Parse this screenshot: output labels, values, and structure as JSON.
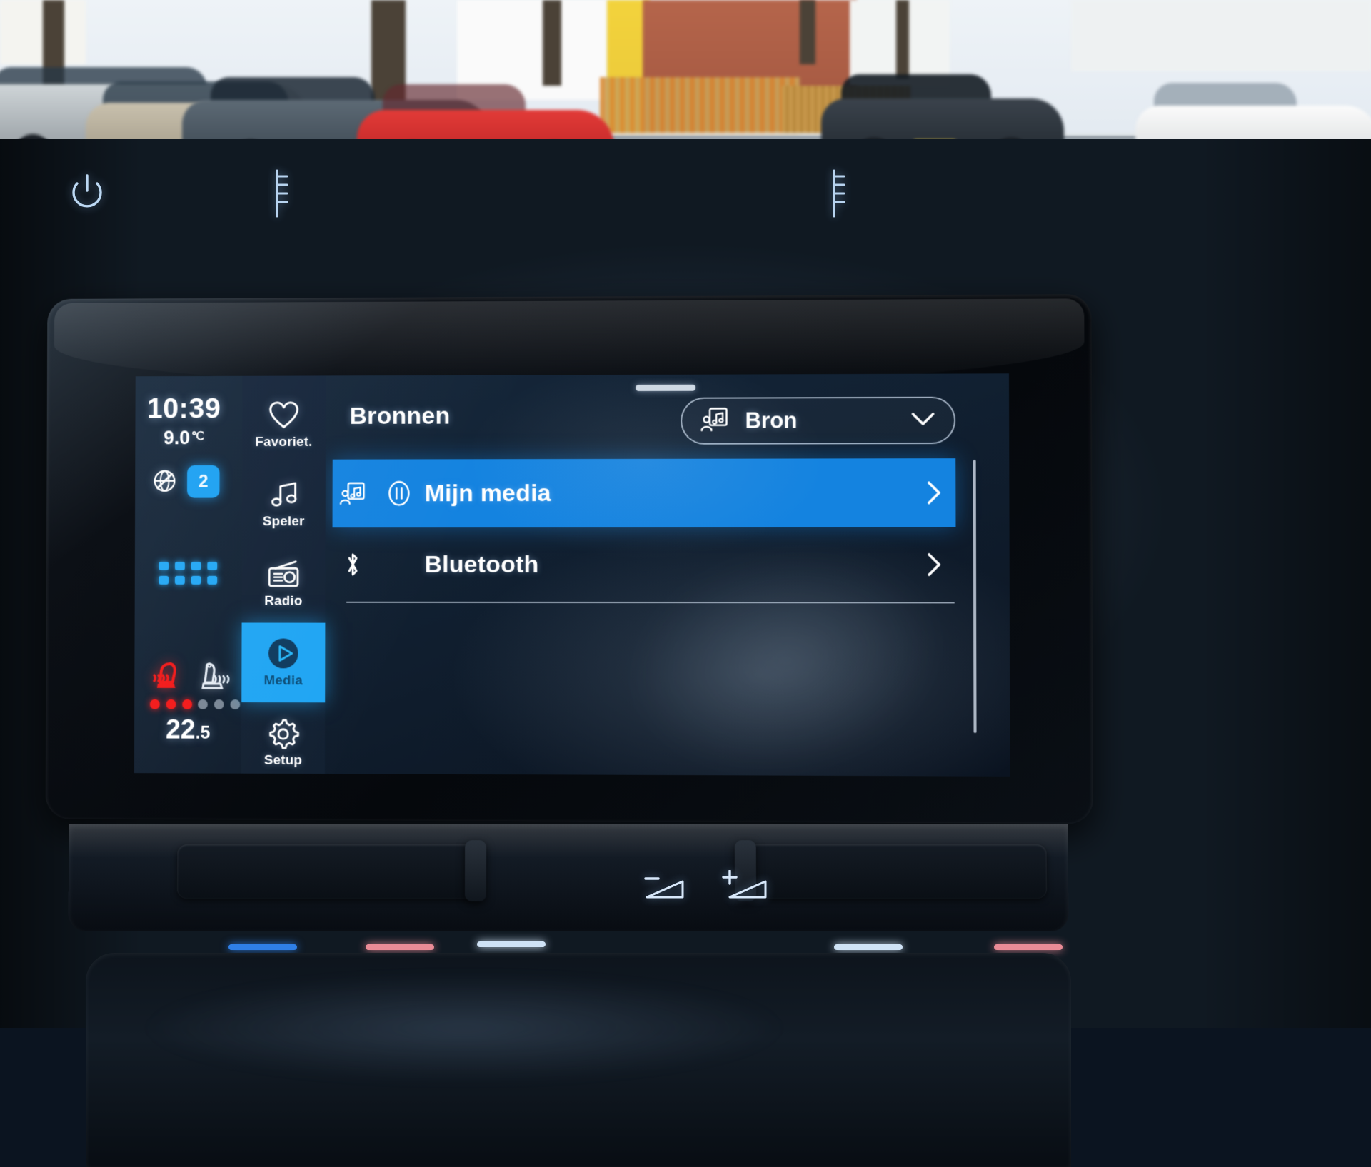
{
  "status": {
    "clock": "10:39",
    "outside_temp": "9.0",
    "temp_unit": "℃",
    "recirculation_icon": "recirculation-off-icon",
    "fan_level": "2",
    "apps_icon": "app-grid-icon",
    "seat_left_icon": "seat-heater-left-icon",
    "seat_right_icon": "seat-ventilation-right-icon",
    "seat_left_level": 3,
    "seat_right_level": 0,
    "cabin_temp_int": "22",
    "cabin_temp_dec": ".5"
  },
  "rail": {
    "items": [
      {
        "label": "Favoriet.",
        "icon": "heart-icon",
        "active": false
      },
      {
        "label": "Speler",
        "icon": "music-note-icon",
        "active": false
      },
      {
        "label": "Radio",
        "icon": "radio-icon",
        "active": false
      },
      {
        "label": "Media",
        "icon": "media-play-icon",
        "active": true
      },
      {
        "label": "Setup",
        "icon": "gear-icon",
        "active": false
      }
    ]
  },
  "pane": {
    "title": "Bronnen",
    "grabber_icon": "drag-handle-icon",
    "source_button": {
      "label": "Bron",
      "icon": "my-media-icon",
      "chevron_icon": "chevron-down-icon"
    },
    "rows": [
      {
        "label": "Mijn media",
        "lead_icon": "my-media-icon",
        "state_icon": "pause-circle-icon",
        "chevron_icon": "chevron-right-icon",
        "selected": true
      },
      {
        "label": "Bluetooth",
        "lead_icon": "bluetooth-icon",
        "state_icon": "",
        "chevron_icon": "chevron-right-icon",
        "selected": false
      }
    ]
  },
  "hardkeys": {
    "power_icon": "power-icon",
    "seat_heater_left_icon": "seat-heater-key-icon",
    "seat_heater_right_icon": "seat-heater-key-icon",
    "volume_down_icon": "volume-down-icon",
    "volume_up_icon": "volume-up-icon"
  },
  "colors": {
    "accent": "#1fa5f3",
    "selected_row": "#1483e0",
    "screen_bg": "#122234",
    "rail_bg": "#14243a",
    "seat_on": "#f31717",
    "seat_off": "#b9c6d4"
  }
}
